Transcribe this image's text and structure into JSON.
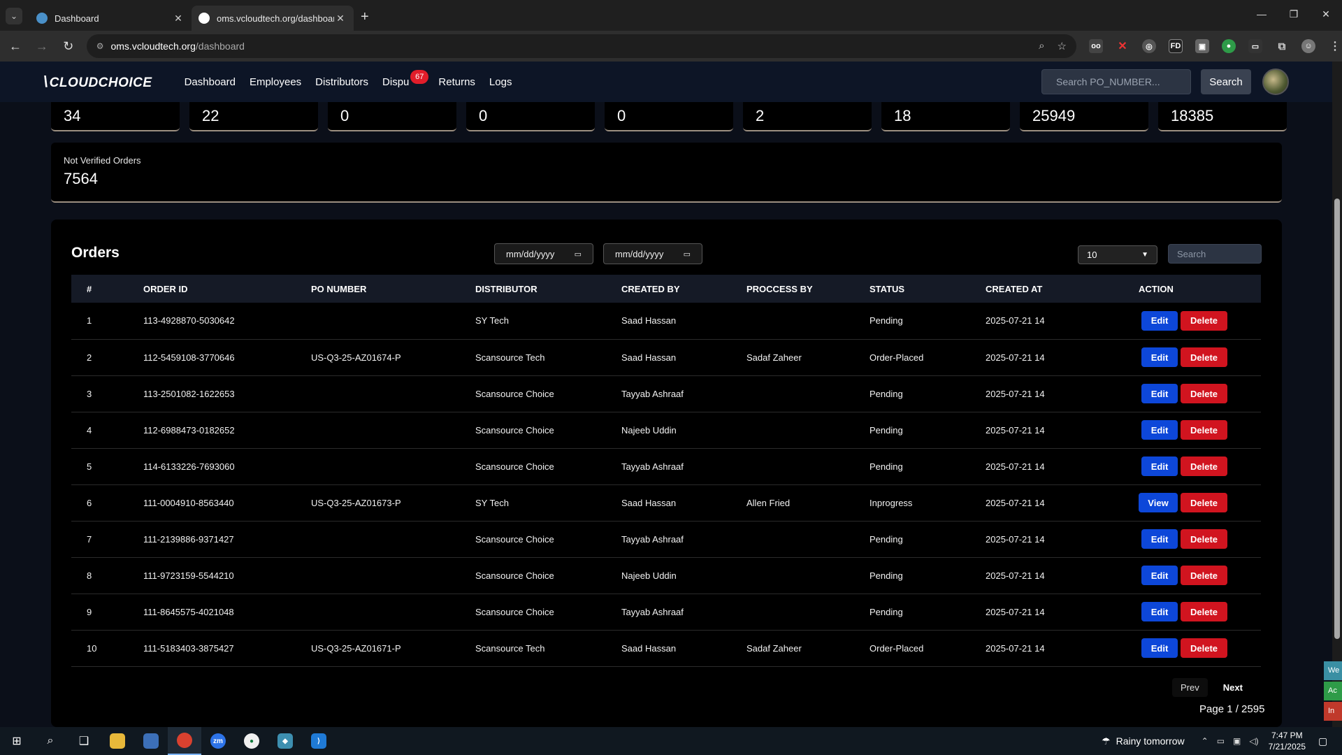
{
  "browser": {
    "tabs": [
      {
        "title": "Dashboard",
        "active": false
      },
      {
        "title": "oms.vcloudtech.org/dashboard",
        "active": true
      }
    ],
    "url_host": "oms.vcloudtech.org",
    "url_path": "/dashboard"
  },
  "nav": {
    "logo": "CLOUDCHOICE",
    "links": [
      "Dashboard",
      "Employees",
      "Distributors",
      "Dispu",
      "Returns",
      "Logs"
    ],
    "disputes_badge": "67",
    "search_placeholder": "Search PO_NUMBER...",
    "search_button": "Search"
  },
  "stats": [
    "34",
    "22",
    "0",
    "0",
    "0",
    "2",
    "18",
    "25949",
    "18385"
  ],
  "not_verified": {
    "label": "Not Verified Orders",
    "value": "7564"
  },
  "orders": {
    "title": "Orders",
    "date_from_placeholder": "mm/dd/yyyy",
    "date_to_placeholder": "mm/dd/yyyy",
    "page_size": "10",
    "search_placeholder": "Search",
    "columns": [
      "#",
      "ORDER ID",
      "PO NUMBER",
      "DISTRIBUTOR",
      "CREATED BY",
      "PROCCESS BY",
      "STATUS",
      "CREATED AT",
      "ACTION"
    ],
    "rows": [
      {
        "n": "1",
        "order_id": "113-4928870-5030642",
        "po": "",
        "distributor": "SY Tech",
        "created_by": "Saad Hassan",
        "process_by": "",
        "status": "Pending",
        "created_at": "2025-07-21 14",
        "action": "Edit"
      },
      {
        "n": "2",
        "order_id": "112-5459108-3770646",
        "po": "US-Q3-25-AZ01674-P",
        "distributor": "Scansource Tech",
        "created_by": "Saad Hassan",
        "process_by": "Sadaf Zaheer",
        "status": "Order-Placed",
        "created_at": "2025-07-21 14",
        "action": "Edit"
      },
      {
        "n": "3",
        "order_id": "113-2501082-1622653",
        "po": "",
        "distributor": "Scansource Choice",
        "created_by": "Tayyab Ashraaf",
        "process_by": "",
        "status": "Pending",
        "created_at": "2025-07-21 14",
        "action": "Edit"
      },
      {
        "n": "4",
        "order_id": "112-6988473-0182652",
        "po": "",
        "distributor": "Scansource Choice",
        "created_by": "Najeeb Uddin",
        "process_by": "",
        "status": "Pending",
        "created_at": "2025-07-21 14",
        "action": "Edit"
      },
      {
        "n": "5",
        "order_id": "114-6133226-7693060",
        "po": "",
        "distributor": "Scansource Choice",
        "created_by": "Tayyab Ashraaf",
        "process_by": "",
        "status": "Pending",
        "created_at": "2025-07-21 14",
        "action": "Edit"
      },
      {
        "n": "6",
        "order_id": "111-0004910-8563440",
        "po": "US-Q3-25-AZ01673-P",
        "distributor": "SY Tech",
        "created_by": "Saad Hassan",
        "process_by": "Allen Fried",
        "status": "Inprogress",
        "created_at": "2025-07-21 14",
        "action": "View"
      },
      {
        "n": "7",
        "order_id": "111-2139886-9371427",
        "po": "",
        "distributor": "Scansource Choice",
        "created_by": "Tayyab Ashraaf",
        "process_by": "",
        "status": "Pending",
        "created_at": "2025-07-21 14",
        "action": "Edit"
      },
      {
        "n": "8",
        "order_id": "111-9723159-5544210",
        "po": "",
        "distributor": "Scansource Choice",
        "created_by": "Najeeb Uddin",
        "process_by": "",
        "status": "Pending",
        "created_at": "2025-07-21 14",
        "action": "Edit"
      },
      {
        "n": "9",
        "order_id": "111-8645575-4021048",
        "po": "",
        "distributor": "Scansource Choice",
        "created_by": "Tayyab Ashraaf",
        "process_by": "",
        "status": "Pending",
        "created_at": "2025-07-21 14",
        "action": "Edit"
      },
      {
        "n": "10",
        "order_id": "111-5183403-3875427",
        "po": "US-Q3-25-AZ01671-P",
        "distributor": "Scansource Tech",
        "created_by": "Saad Hassan",
        "process_by": "Sadaf Zaheer",
        "status": "Order-Placed",
        "created_at": "2025-07-21 14",
        "action": "Edit"
      }
    ],
    "delete_label": "Delete",
    "prev_label": "Prev",
    "next_label": "Next",
    "page_info": "Page 1 / 2595"
  },
  "side_tabs": [
    "We",
    "Ac",
    "In"
  ],
  "taskbar": {
    "weather": "Rainy tomorrow",
    "time": "7:47 PM",
    "date": "7/21/2025"
  },
  "colors": {
    "edit": "#0d47d9",
    "delete": "#d1141f",
    "badge": "#e11d2a",
    "nav_bg": "#0d1526"
  }
}
